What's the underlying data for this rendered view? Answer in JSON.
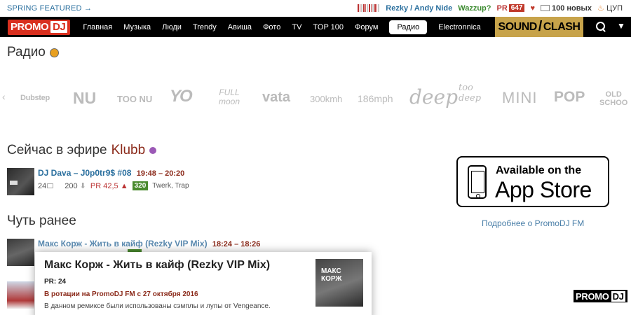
{
  "topbar": {
    "featured": "SPRING FEATURED →",
    "now_track": "Rezky / Andy Nide",
    "wazzup": "Wazzup?",
    "pr_label": "PR",
    "pr_value": "647",
    "news": "100 новых",
    "cup": "ЦУП"
  },
  "nav": {
    "logo_main": "PROMO",
    "logo_dj": "DJ",
    "items": [
      "Главная",
      "Музыка",
      "Люди",
      "Trendy",
      "Авиша",
      "Фото",
      "TV",
      "TOP 100",
      "Форум",
      "Радио",
      "Electronnica"
    ],
    "active": "Радио",
    "soundclash_a": "SOUND",
    "soundclash_b": "CLASH"
  },
  "page": {
    "title": "Радио"
  },
  "stations": {
    "dubstep": "Dubstep",
    "nu": "NU",
    "toonu": "TOO NU",
    "yo": "YO",
    "full": "FULL",
    "moon": "moon",
    "vata": "vata",
    "kmh": "300kmh",
    "mph": "186mph",
    "deep": "deep",
    "too": "too",
    "deep2": "deep",
    "mini": "MINI",
    "pop": "POP",
    "old": "OLD",
    "school": "SCHOO"
  },
  "on_air": {
    "heading": "Сейчас в эфире",
    "station": "Klubb",
    "track": {
      "title": "DJ Dava – J0p0tr9$ #08",
      "time": "19:48 – 20:20",
      "comments": "24",
      "downloads": "200",
      "pr": "PR 42,5 ▲",
      "bpm": "320",
      "genre": "Twerk, Trap"
    }
  },
  "earlier": {
    "heading": "Чуть ранее",
    "tracks": [
      {
        "title": "Макс Корж - Жить в кайф (Rezky VIP Mix)",
        "time": "18:24 – 18:26"
      }
    ]
  },
  "appstore": {
    "small": "Available on the",
    "big": "App Store",
    "link": "Подробнее о PromoDJ FM"
  },
  "popup": {
    "title": "Макс Корж - Жить в кайф (Rezky VIP Mix)",
    "pr": "PR: 24",
    "rotation": "В ротации на PromoDJ FM с 27 октября 2016",
    "description": "В данном ремиксе были использованы сэмплы и лупы от Vengeance.",
    "cover_text": "МАКС КОРЖ"
  },
  "footer_logo": {
    "main": "PROMO",
    "dj": "DJ"
  }
}
